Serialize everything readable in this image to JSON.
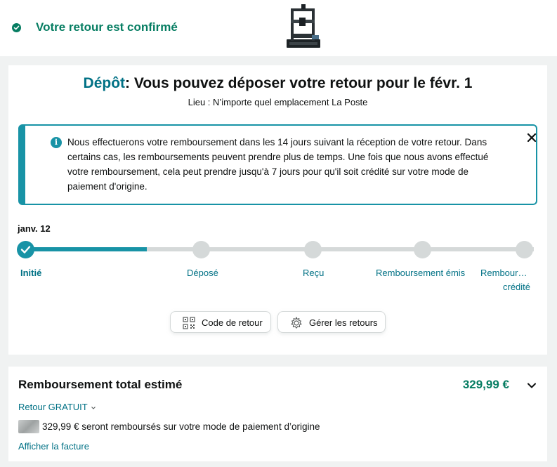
{
  "banner": {
    "confirm_text": "Votre retour est confirmé",
    "confirm_icon": "check-circle-icon",
    "product_image": "3d-printer"
  },
  "main": {
    "headline_accent": "Dépôt",
    "headline_rest": ": Vous pouvez déposer votre retour pour le févr. 1",
    "location": "Lieu : N’importe quel emplacement La Poste",
    "alert": {
      "icon": "info-icon",
      "text": "Nous effectuerons votre remboursement dans les 14 jours suivant la réception de votre retour. Dans certains cas, les remboursements peuvent prendre plus de temps. Une fois que nous avons effectué votre remboursement, cela peut prendre jusqu'à 7 jours pour qu'il soit crédité sur votre mode de paiement d'origine.",
      "close_icon": "close-icon"
    },
    "timeline": {
      "date": "janv. 12",
      "steps": [
        {
          "label": "Initié",
          "done": true
        },
        {
          "label": "Déposé",
          "done": false
        },
        {
          "label": "Reçu",
          "done": false
        },
        {
          "label": "Remboursement émis",
          "done": false
        },
        {
          "label": "Rembour…",
          "label2": "crédité",
          "done": false
        }
      ]
    },
    "buttons": {
      "return_code": "Code de retour",
      "manage_returns": "Gérer les retours"
    }
  },
  "refund": {
    "title": "Remboursement total estimé",
    "amount": "329,99 €",
    "return_free": "Retour GRATUIT",
    "description": "329,99 € seront remboursés sur votre mode de paiement d’origine",
    "invoice_link": "Afficher la facture"
  },
  "colors": {
    "accent_teal": "#1893a6",
    "link_teal": "#007185",
    "success_green": "#067d62",
    "track_grey": "#d5d9d9"
  }
}
